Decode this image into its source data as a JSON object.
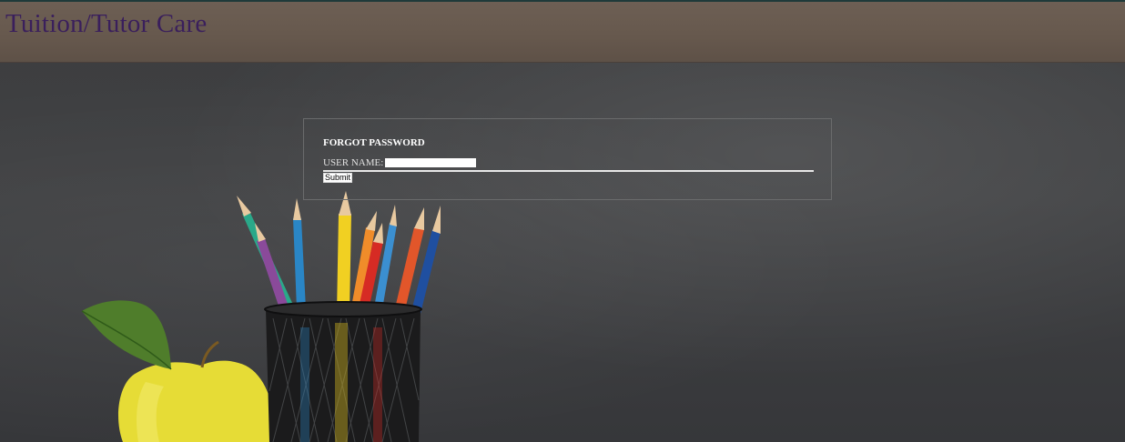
{
  "header": {
    "title": "Tuition/Tutor Care",
    "title_color": "#3a1f5c",
    "background": "#6a5c51"
  },
  "form": {
    "heading": "FORGOT PASSWORD",
    "username_label": "USER NAME:",
    "username_value": "",
    "submit_label": "Submit"
  },
  "background": {
    "scene": "chalkboard-with-pencil-cup-and-apple",
    "board_color": "#3c3d3f",
    "icons": [
      "apple-icon",
      "pencil-cup-icon",
      "colored-pencils-icon"
    ]
  }
}
